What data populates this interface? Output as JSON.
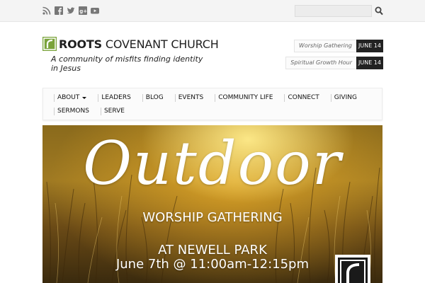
{
  "topbar": {
    "social_icons": [
      "rss-icon",
      "facebook-icon",
      "twitter-icon",
      "google-plus-icon",
      "youtube-icon"
    ],
    "search": {
      "value": "",
      "placeholder": ""
    }
  },
  "header": {
    "title_bold": "ROOTS",
    "title_rest": " COVENANT CHURCH",
    "tagline": "A community of misfits finding identity in Jesus",
    "brand_color": "#7aa33a"
  },
  "events": [
    {
      "name": "Worship Gathering",
      "date": "JUNE 14"
    },
    {
      "name": "Spiritual Growth Hour",
      "date": "JUNE 14"
    }
  ],
  "nav": {
    "row1": [
      {
        "label": "ABOUT",
        "has_dropdown": true
      },
      {
        "label": "LEADERS"
      },
      {
        "label": "BLOG"
      },
      {
        "label": "EVENTS"
      },
      {
        "label": "COMMUNITY LIFE"
      },
      {
        "label": "CONNECT"
      },
      {
        "label": "GIVING"
      }
    ],
    "row2": [
      {
        "label": "SERMONS"
      },
      {
        "label": "SERVE"
      }
    ]
  },
  "hero": {
    "title": "Outdoor",
    "subtitle": "WORSHIP GATHERING",
    "location": "AT NEWELL PARK",
    "time": "June 7th @ 11:00am-12:15pm"
  }
}
